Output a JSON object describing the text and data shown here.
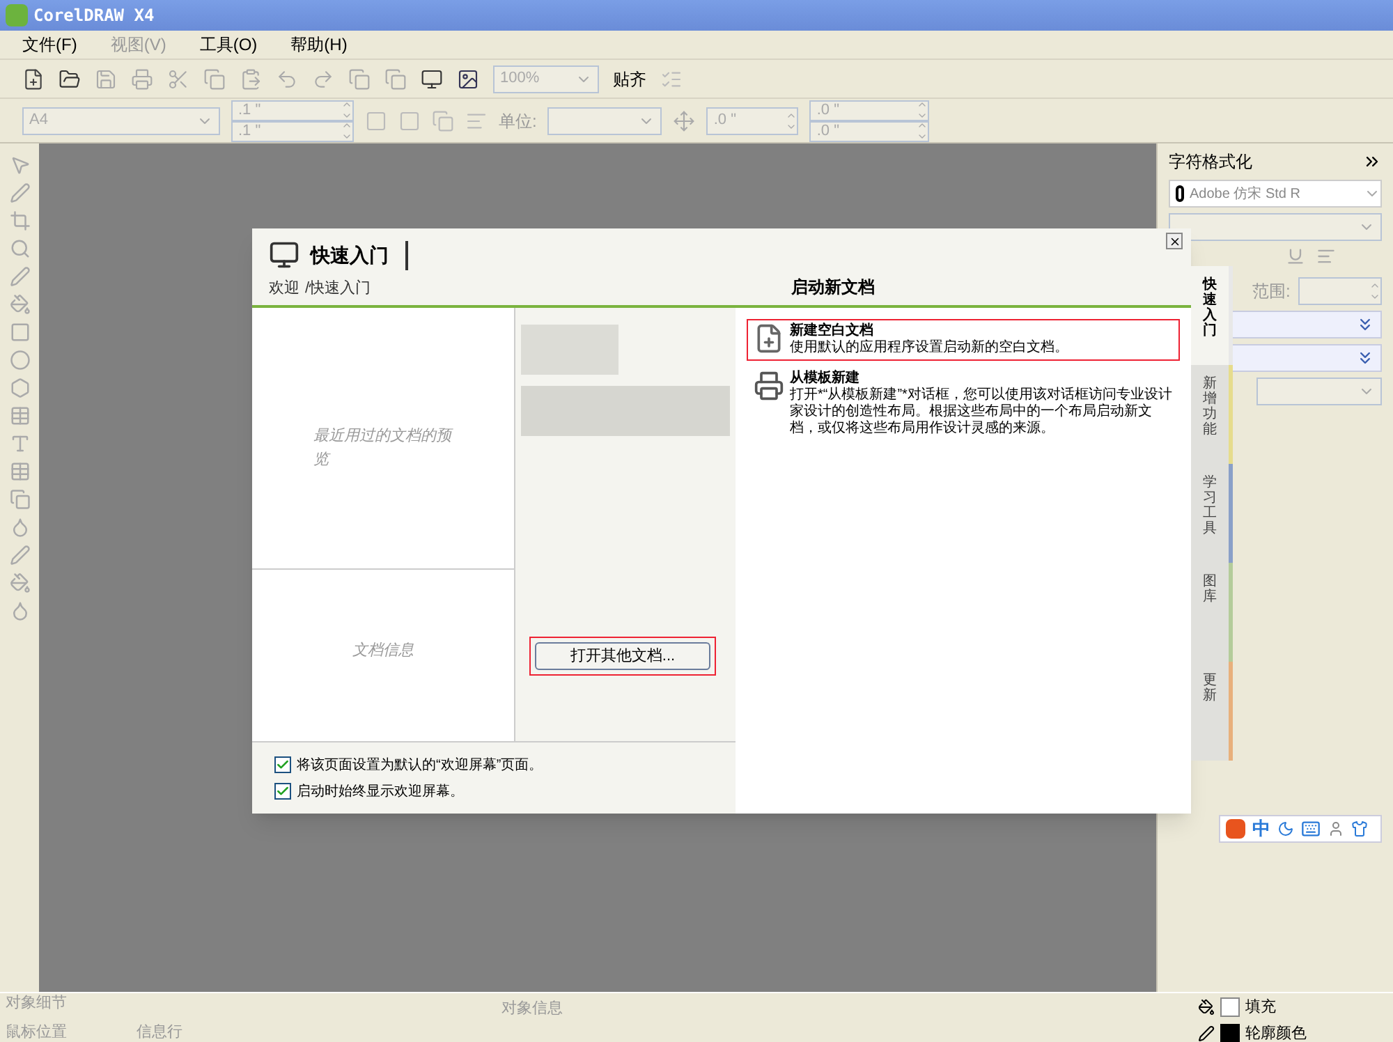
{
  "window": {
    "title": "CorelDRAW X4"
  },
  "menu": [
    {
      "label": "文件(F)",
      "disabled": false
    },
    {
      "label": "视图(V)",
      "disabled": true
    },
    {
      "label": "工具(O)",
      "disabled": false
    },
    {
      "label": "帮助(H)",
      "disabled": false
    }
  ],
  "toolbar": {
    "zoom": "100%",
    "snap": "贴齐"
  },
  "property_bar": {
    "page_size": "A4",
    "width": ".1 \"",
    "height": ".1 \"",
    "unit_label": "单位:",
    "nudge": ".0 \"",
    "dup_x": ".0 \"",
    "dup_y": ".0 \""
  },
  "dialog": {
    "title": "快速入门",
    "breadcrumb": [
      "欢迎",
      "快速入门"
    ],
    "breadcrumb_separator": "/",
    "recent_label": "最近用过的文档的预览",
    "doc_info_label": "文档信息",
    "open_button": "打开其他文档...",
    "checkboxes": [
      {
        "label": "将该页面设置为默认的“欢迎屏幕”页面。",
        "checked": true
      },
      {
        "label": "启动时始终显示欢迎屏幕。",
        "checked": true
      }
    ],
    "section_title": "启动新文档",
    "actions": [
      {
        "kind": "blank",
        "title": "新建空白文档",
        "description": "使用默认的应用程序设置启动新的空白文档。",
        "highlighted": true
      },
      {
        "kind": "template",
        "title": "从模板新建",
        "description": "打开*“从模板新建”*对话框，您可以使用该对话框访问专业设计家设计的创造性布局。根据这些布局中的一个布局启动新文档，或仅将这些布局用作设计灵感的来源。",
        "highlighted": false
      }
    ],
    "tabs": [
      {
        "label": "快速入门",
        "selected": true,
        "color": "#e8e8e8"
      },
      {
        "label": "新增功能",
        "selected": false,
        "color": "#e6dc8c"
      },
      {
        "label": "学习工具",
        "selected": false,
        "color": "#8aa0c8"
      },
      {
        "label": "图库",
        "selected": false,
        "color": "#b4cc9a"
      },
      {
        "label": "更新",
        "selected": false,
        "color": "#e8b07c"
      }
    ]
  },
  "docker": {
    "title": "字符格式化",
    "font": "Adobe 仿宋 Std R",
    "range_label": "范围:"
  },
  "ime": {
    "label": "中"
  },
  "status": {
    "object_details": "对象细节",
    "mouse_position": "鼠标位置",
    "info_line": "信息行",
    "object_info": "对象信息",
    "fill_label": "填充",
    "outline_label": "轮廓颜色"
  }
}
